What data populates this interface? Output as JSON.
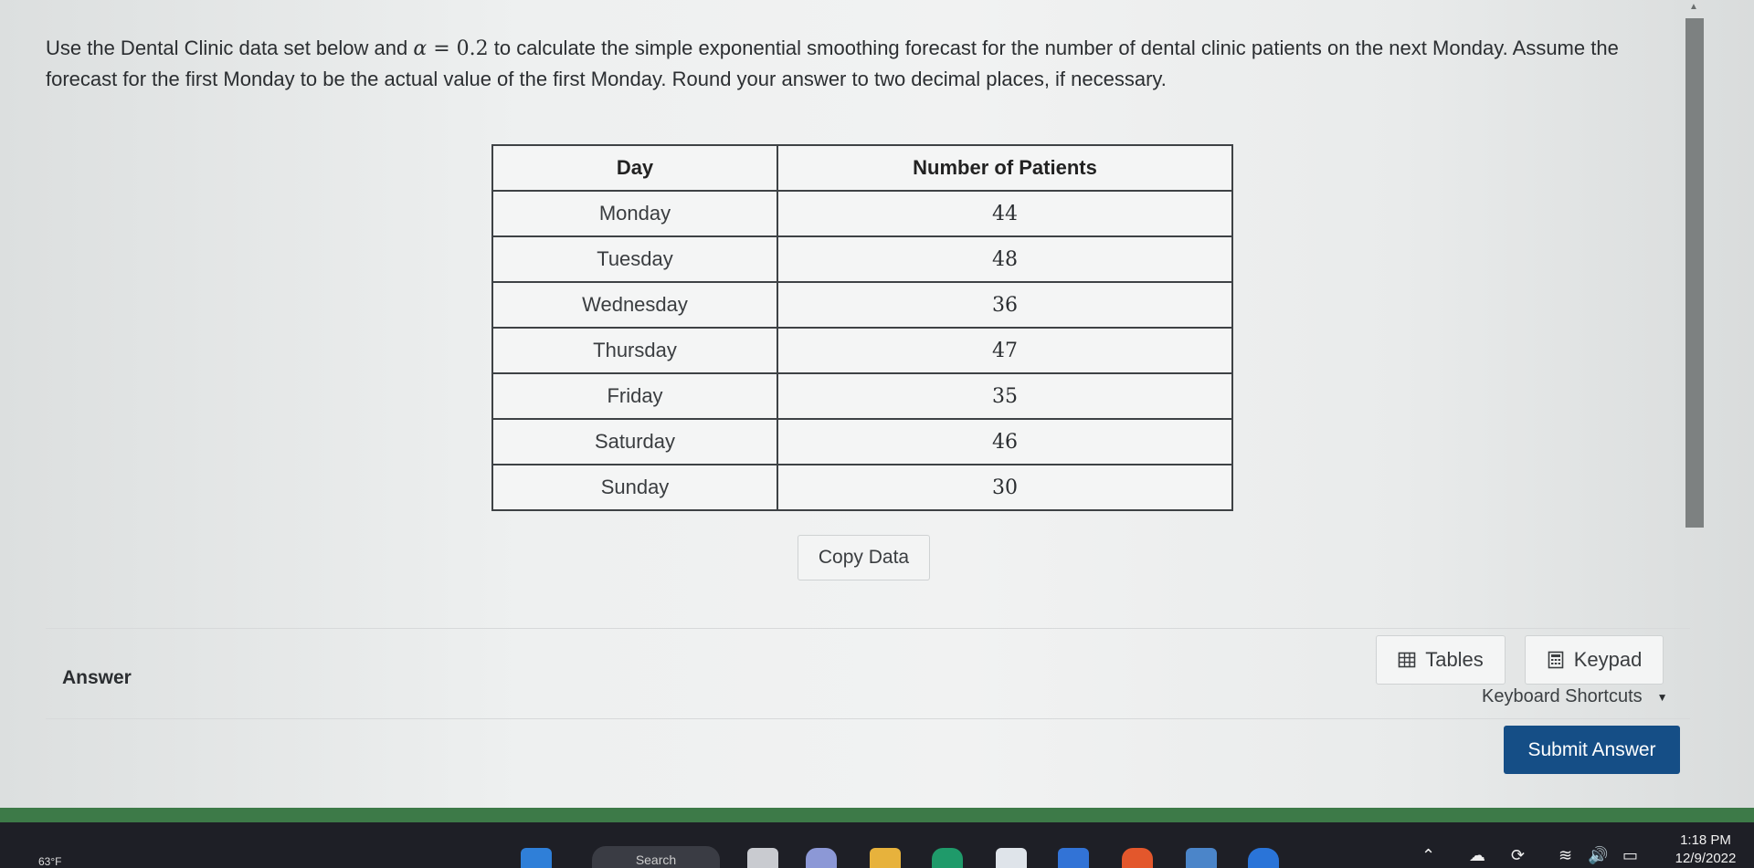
{
  "question": {
    "part1": "Use the Dental Clinic data set below and ",
    "alpha_symbol": "α",
    "equals": " = ",
    "alpha_value": "0.2",
    "part2": " to calculate the simple exponential smoothing forecast for the number of dental clinic patients on the next Monday. Assume the forecast for the first Monday to be the actual value of the first Monday. Round your answer to two decimal places, if necessary."
  },
  "table": {
    "headers": [
      "Day",
      "Number of Patients"
    ],
    "rows": [
      {
        "day": "Monday",
        "patients": "44"
      },
      {
        "day": "Tuesday",
        "patients": "48"
      },
      {
        "day": "Wednesday",
        "patients": "36"
      },
      {
        "day": "Thursday",
        "patients": "47"
      },
      {
        "day": "Friday",
        "patients": "35"
      },
      {
        "day": "Saturday",
        "patients": "46"
      },
      {
        "day": "Sunday",
        "patients": "30"
      }
    ]
  },
  "copy_data_label": "Copy Data",
  "answer": {
    "label": "Answer",
    "tables_label": "Tables",
    "keypad_label": "Keypad",
    "shortcuts_label": "Keyboard Shortcuts"
  },
  "submit_label": "Submit Answer",
  "taskbar": {
    "weather": "63°F",
    "search": "Search",
    "time": "1:18 PM",
    "date": "12/9/2022"
  },
  "colors": {
    "submit_bg": "#154e86",
    "table_border": "#3e4245"
  }
}
